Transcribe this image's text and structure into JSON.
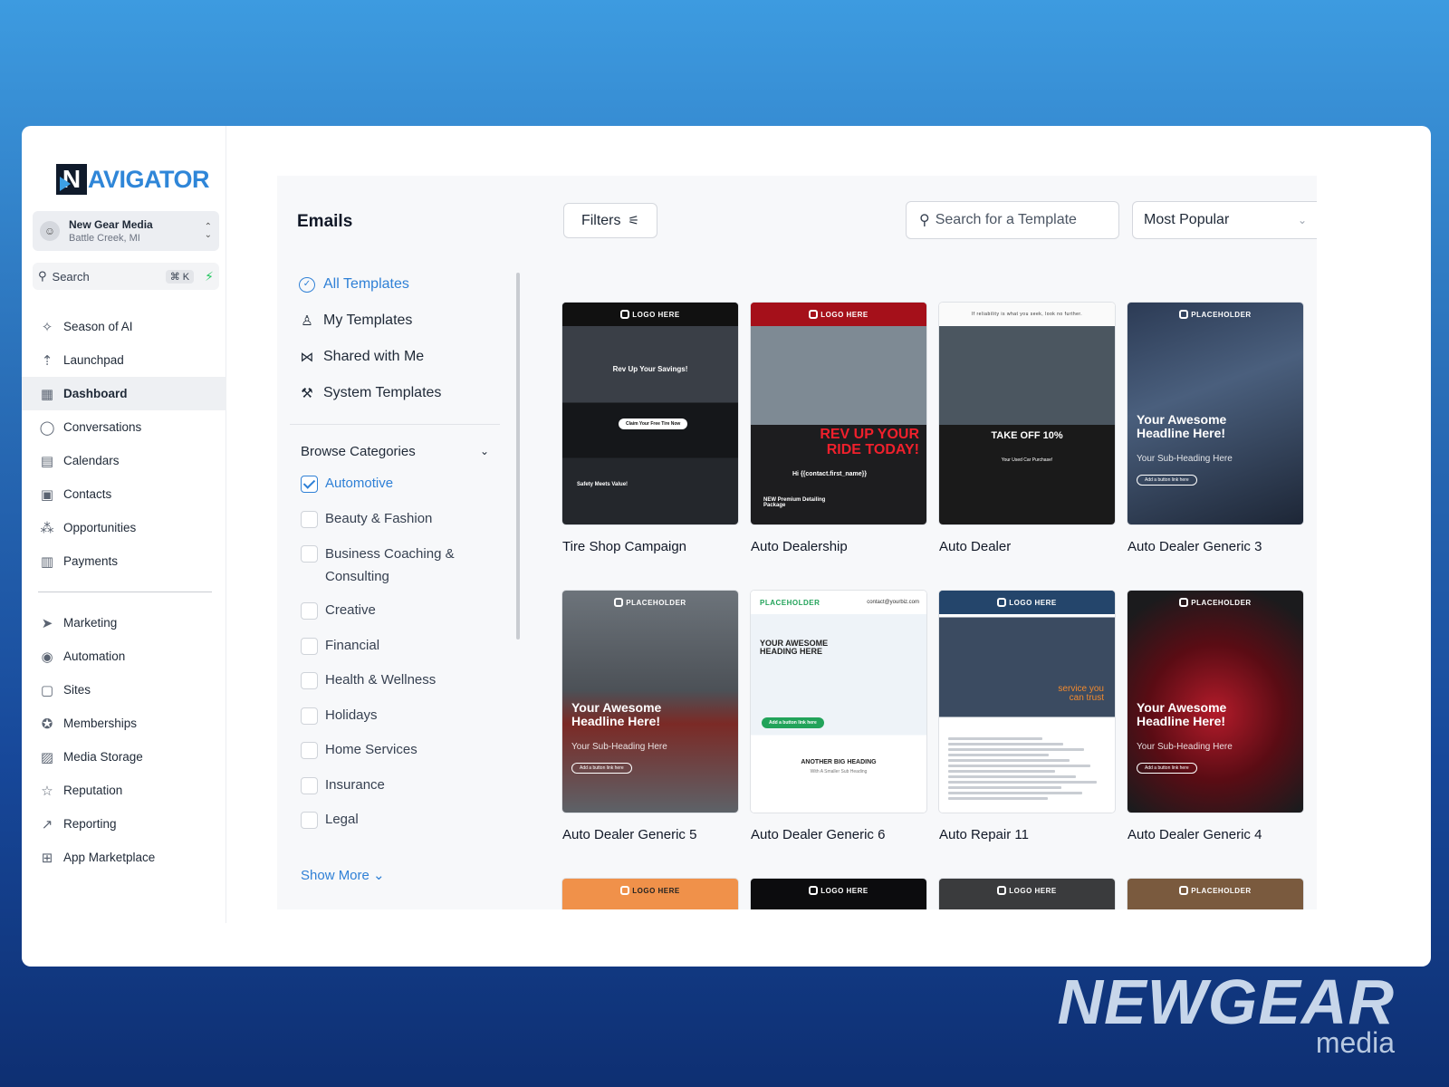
{
  "brand": {
    "logo_letter": "N",
    "logo_rest": "AVIGATOR"
  },
  "account": {
    "name": "New Gear Media",
    "location": "Battle Creek, MI"
  },
  "sidebar_search": {
    "label": "Search",
    "shortcut": "⌘ K"
  },
  "nav": {
    "primary": [
      {
        "label": "Season of AI",
        "icon": "sparkle-icon",
        "glyph": "✧"
      },
      {
        "label": "Launchpad",
        "icon": "rocket-icon",
        "glyph": "⇡"
      },
      {
        "label": "Dashboard",
        "icon": "dashboard-icon",
        "glyph": "▦",
        "active": true
      },
      {
        "label": "Conversations",
        "icon": "chat-icon",
        "glyph": "◯"
      },
      {
        "label": "Calendars",
        "icon": "calendar-icon",
        "glyph": "▤"
      },
      {
        "label": "Contacts",
        "icon": "contacts-icon",
        "glyph": "▣"
      },
      {
        "label": "Opportunities",
        "icon": "opportunities-icon",
        "glyph": "⁂"
      },
      {
        "label": "Payments",
        "icon": "payments-icon",
        "glyph": "▥"
      }
    ],
    "secondary": [
      {
        "label": "Marketing",
        "icon": "send-icon",
        "glyph": "➤"
      },
      {
        "label": "Automation",
        "icon": "automation-icon",
        "glyph": "◉"
      },
      {
        "label": "Sites",
        "icon": "sites-icon",
        "glyph": "▢"
      },
      {
        "label": "Memberships",
        "icon": "badge-icon",
        "glyph": "✪"
      },
      {
        "label": "Media Storage",
        "icon": "image-icon",
        "glyph": "▨"
      },
      {
        "label": "Reputation",
        "icon": "star-icon",
        "glyph": "☆"
      },
      {
        "label": "Reporting",
        "icon": "trend-icon",
        "glyph": "↗"
      },
      {
        "label": "App Marketplace",
        "icon": "apps-icon",
        "glyph": "⊞"
      }
    ]
  },
  "main": {
    "title": "Emails",
    "filters_label": "Filters",
    "search_placeholder": "Search for a Template",
    "sort_value": "Most Popular",
    "template_links": [
      {
        "label": "All Templates",
        "icon": "check-circle-icon",
        "glyph": "✓",
        "active": true
      },
      {
        "label": "My Templates",
        "icon": "user-icon",
        "glyph": "♙"
      },
      {
        "label": "Shared with Me",
        "icon": "share-icon",
        "glyph": "⋈"
      },
      {
        "label": "System Templates",
        "icon": "wrench-icon",
        "glyph": "⚒"
      }
    ],
    "browse_label": "Browse Categories",
    "categories": [
      {
        "label": "Automotive",
        "checked": true
      },
      {
        "label": "Beauty & Fashion",
        "checked": false
      },
      {
        "label": "Business Coaching & Consulting",
        "checked": false
      },
      {
        "label": "Creative",
        "checked": false
      },
      {
        "label": "Financial",
        "checked": false
      },
      {
        "label": "Health & Wellness",
        "checked": false
      },
      {
        "label": "Holidays",
        "checked": false
      },
      {
        "label": "Home Services",
        "checked": false
      },
      {
        "label": "Insurance",
        "checked": false
      },
      {
        "label": "Legal",
        "checked": false
      }
    ],
    "show_more": "Show More",
    "templates": [
      {
        "name": "Tire Shop Campaign",
        "header": "LOGO HERE",
        "headline": "Rev Up Your Savings!",
        "cta": "Claim Your Free Tire Now",
        "sub": "Safety Meets Value!"
      },
      {
        "name": "Auto Dealership",
        "header": "LOGO HERE",
        "headline": "REV UP YOUR RIDE TODAY!",
        "greeting": "Hi {{contact.first_name}}",
        "sub": "NEW Premium Detailing Package"
      },
      {
        "name": "Auto Dealer",
        "header": "If reliability is what you seek, look no further.",
        "headline": "TAKE OFF 10%",
        "sub": "Your Used Car Purchase!"
      },
      {
        "name": "Auto Dealer Generic 3",
        "header": "PLACEHOLDER",
        "headline": "Your Awesome Headline Here!",
        "sub": "Your Sub-Heading Here",
        "cta": "Add a button link here"
      },
      {
        "name": "Auto Dealer Generic 5",
        "header": "PLACEHOLDER",
        "headline": "Your Awesome Headline Here!",
        "sub": "Your Sub-Heading Here",
        "cta": "Add a button link here"
      },
      {
        "name": "Auto Dealer Generic 6",
        "header": "PLACEHOLDER",
        "contact": "contact@yourbiz.com",
        "headline": "YOUR AWESOME HEADING HERE",
        "cta": "Add a button link here",
        "sub": "ANOTHER BIG HEADING",
        "sub2": "With A Smaller Sub Heading"
      },
      {
        "name": "Auto Repair 11",
        "header": "LOGO HERE",
        "badge": "service you can trust"
      },
      {
        "name": "Auto Dealer Generic 4",
        "header": "PLACEHOLDER",
        "headline": "Your Awesome Headline Here!",
        "sub": "Your Sub-Heading Here",
        "cta": "Add a button link here"
      }
    ],
    "partial_row": [
      "LOGO HERE",
      "LOGO HERE",
      "LOGO HERE",
      "PLACEHOLDER"
    ]
  },
  "footer_brand": {
    "main": "NEWGEAR",
    "sub": "media"
  },
  "colors": {
    "accent": "#2f80d6",
    "brand_blue": "#2f86d8",
    "bolt": "#22c55e"
  }
}
